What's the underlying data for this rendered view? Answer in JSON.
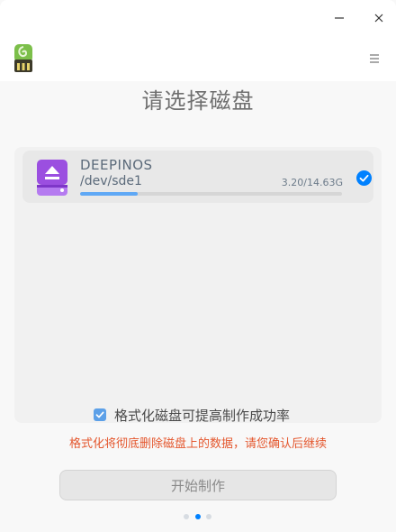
{
  "window": {
    "title": "",
    "controls": [
      "minimize-icon",
      "close-icon"
    ]
  },
  "toolbar": {
    "app_icon": "usb-drive-icon",
    "menu_icon": "hamburger-menu-icon"
  },
  "page": {
    "title": "请选择磁盘"
  },
  "disks": [
    {
      "name": "DEEPINOS",
      "path": "/dev/sde1",
      "size": "3.20/14.63G",
      "usage_fraction": 0.219,
      "selected": true,
      "icon": "eject-disk-icon"
    }
  ],
  "format_option": {
    "label": "格式化磁盘可提高制作成功率",
    "checked": true
  },
  "warning_text": "格式化将彻底删除磁盘上的数据，请您确认后继续",
  "start_button": {
    "label": "开始制作",
    "enabled": false
  },
  "pagination": {
    "total": 3,
    "current": 2
  },
  "colors": {
    "accent": "#0081ff",
    "warning": "#e4572e",
    "disk_icon": "#9b4fe0"
  }
}
